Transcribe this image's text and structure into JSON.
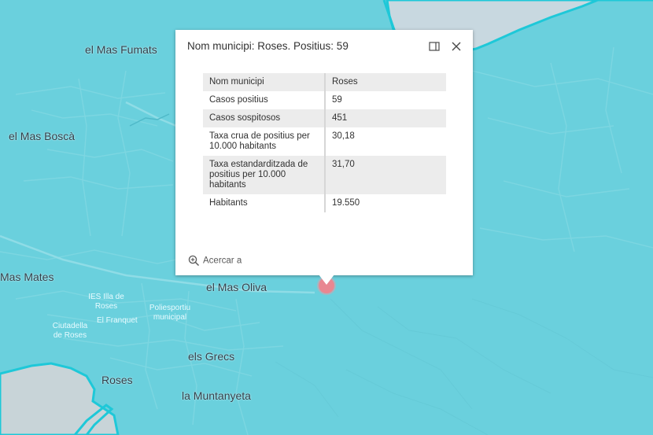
{
  "popup": {
    "title": "Nom municipi: Roses. Positius: 59",
    "zoom_label": "Acercar a",
    "rows": [
      {
        "key": "Nom municipi",
        "value": "Roses"
      },
      {
        "key": "Casos positius",
        "value": "59"
      },
      {
        "key": "Casos sospitosos",
        "value": "451"
      },
      {
        "key": "Taxa crua de positius per 10.000 habitants",
        "value": "30,18"
      },
      {
        "key": "Taxa estandarditzada de positius per 10.000 habitants",
        "value": "31,70"
      },
      {
        "key": "Habitants",
        "value": "19.550"
      }
    ]
  },
  "map": {
    "places": [
      "el Mas Fumats",
      "el Mas Boscà",
      "Mas Mates",
      "el Mas Oliva",
      "els Grecs",
      "Roses",
      "la Muntanyeta"
    ],
    "pois": [
      "IES Illa de Roses",
      "Poliesportiu municipal",
      "El Franquet",
      "Ciutadella de Roses"
    ],
    "colors": {
      "municipality_fill": "#6ad0dd",
      "boundary": "#1ec8d8",
      "sea": "#c8d8e0",
      "marker": "#e88791"
    }
  },
  "icons": [
    "dock-icon",
    "close-icon",
    "zoom-in-icon"
  ]
}
